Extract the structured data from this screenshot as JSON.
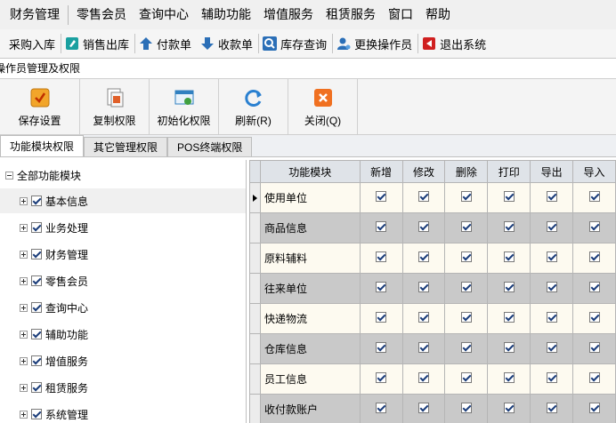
{
  "menu": [
    "财务管理",
    "零售会员",
    "查询中心",
    "辅助功能",
    "增值服务",
    "租赁服务",
    "窗口",
    "帮助"
  ],
  "toolbar": [
    {
      "label": "采购入库",
      "icon": "purchase-icon",
      "color": "#2b6fb7"
    },
    {
      "label": "销售出库",
      "icon": "sales-icon",
      "color": "#1a9a9a"
    },
    {
      "label": "付款单",
      "icon": "payment-icon",
      "color": "#2b6fb7"
    },
    {
      "label": "收款单",
      "icon": "receipt-icon",
      "color": "#2b6fb7"
    },
    {
      "label": "库存查询",
      "icon": "search-icon",
      "color": "#2b6fb7"
    },
    {
      "label": "更换操作员",
      "icon": "user-switch-icon",
      "color": "#2b6fb7"
    },
    {
      "label": "退出系统",
      "icon": "exit-icon",
      "color": "#d02020"
    }
  ],
  "window_title": "操作员管理及权限",
  "ribbon": [
    {
      "label": "保存设置",
      "icon": "save-check-icon",
      "color": "#f0a020"
    },
    {
      "label": "复制权限",
      "icon": "copy-document-icon",
      "color": "#e06020"
    },
    {
      "label": "初始化权限",
      "icon": "initialize-icon",
      "color": "#3080c0"
    },
    {
      "label": "刷新(R)",
      "icon": "refresh-icon",
      "color": "#2a80d0"
    },
    {
      "label": "关闭(Q)",
      "icon": "close-icon",
      "color": "#f07020"
    }
  ],
  "tabs": [
    "功能模块权限",
    "其它管理权限",
    "POS终端权限"
  ],
  "tree": {
    "root": "全部功能模块",
    "items": [
      "基本信息",
      "业务处理",
      "财务管理",
      "零售会员",
      "查询中心",
      "辅助功能",
      "增值服务",
      "租赁服务",
      "系统管理"
    ]
  },
  "grid": {
    "columns": [
      "功能模块",
      "新增",
      "修改",
      "删除",
      "打印",
      "导出",
      "导入"
    ],
    "rows": [
      "使用单位",
      "商品信息",
      "原料辅料",
      "往来单位",
      "快递物流",
      "仓库信息",
      "员工信息",
      "收付款账户"
    ]
  },
  "colors": {
    "row_odd": "#fdfaf0",
    "row_even": "#c9c9c9",
    "header": "#dfe3e8"
  }
}
